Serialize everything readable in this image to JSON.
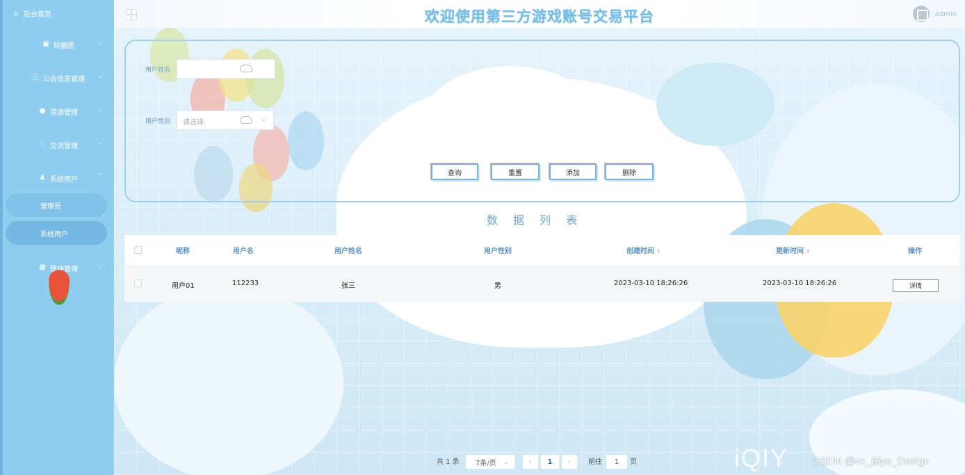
{
  "header": {
    "title": "欢迎使用第三方游戏账号交易平台",
    "username": "admin"
  },
  "sidebar": {
    "home": "后台首页",
    "items": [
      {
        "label": "轮播图",
        "icon": "image-icon"
      },
      {
        "label": "公告信息管理",
        "icon": "info-icon"
      },
      {
        "label": "资源管理",
        "icon": "location-icon"
      },
      {
        "label": "交流管理",
        "icon": "chat-icon"
      },
      {
        "label": "系统用户",
        "icon": "user-icon"
      },
      {
        "label": "模块管理",
        "icon": "grid-icon"
      }
    ],
    "sub_items": [
      {
        "label": "管理员"
      },
      {
        "label": "系统用户"
      }
    ]
  },
  "search": {
    "name_label": "用户姓名",
    "gender_label": "用户性别",
    "gender_placeholder": "请选择",
    "buttons": {
      "query": "查询",
      "reset": "重置",
      "add": "添加",
      "delete": "删除"
    }
  },
  "list_title": "数据列表",
  "table": {
    "headers": [
      "昵称",
      "用户名",
      "用户姓名",
      "用户性别",
      "创建时间",
      "更新时间",
      "操作"
    ],
    "rows": [
      {
        "nickname": "用户01",
        "username": "112233",
        "name": "张三",
        "gender": "男",
        "created": "2023-03-10 18:26:26",
        "updated": "2023-03-10 18:26:26",
        "action": "详情"
      }
    ]
  },
  "pagination": {
    "total": "共 1 条",
    "page_size": "7条/页",
    "current": "1",
    "goto_label": "前往",
    "goto_value": "1",
    "page_unit": "页",
    "prev": "‹",
    "next": "›"
  },
  "watermark": "CSDN @vx_Biye_Design",
  "video_logo": "iQIY"
}
